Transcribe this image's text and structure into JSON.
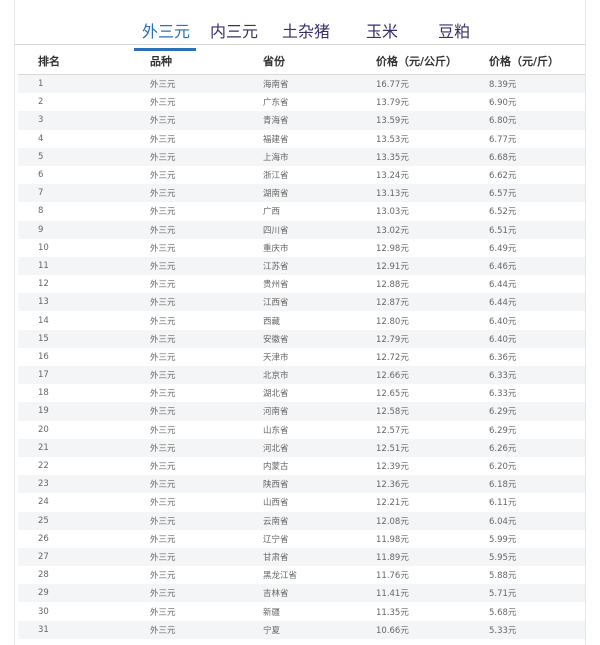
{
  "tabs": [
    "外三元",
    "内三元",
    "土杂猪",
    "玉米",
    "豆粕"
  ],
  "table": {
    "headers": [
      "排名",
      "品种",
      "省份",
      "价格（元/公斤）",
      "价格（元/斤）"
    ],
    "rows": [
      [
        "1",
        "外三元",
        "海南省",
        "16.77元",
        "8.39元"
      ],
      [
        "2",
        "外三元",
        "广东省",
        "13.79元",
        "6.90元"
      ],
      [
        "3",
        "外三元",
        "青海省",
        "13.59元",
        "6.80元"
      ],
      [
        "4",
        "外三元",
        "福建省",
        "13.53元",
        "6.77元"
      ],
      [
        "5",
        "外三元",
        "上海市",
        "13.35元",
        "6.68元"
      ],
      [
        "6",
        "外三元",
        "浙江省",
        "13.24元",
        "6.62元"
      ],
      [
        "7",
        "外三元",
        "湖南省",
        "13.13元",
        "6.57元"
      ],
      [
        "8",
        "外三元",
        "广西",
        "13.03元",
        "6.52元"
      ],
      [
        "9",
        "外三元",
        "四川省",
        "13.02元",
        "6.51元"
      ],
      [
        "10",
        "外三元",
        "重庆市",
        "12.98元",
        "6.49元"
      ],
      [
        "11",
        "外三元",
        "江苏省",
        "12.91元",
        "6.46元"
      ],
      [
        "12",
        "外三元",
        "贵州省",
        "12.88元",
        "6.44元"
      ],
      [
        "13",
        "外三元",
        "江西省",
        "12.87元",
        "6.44元"
      ],
      [
        "14",
        "外三元",
        "西藏",
        "12.80元",
        "6.40元"
      ],
      [
        "15",
        "外三元",
        "安徽省",
        "12.79元",
        "6.40元"
      ],
      [
        "16",
        "外三元",
        "天津市",
        "12.72元",
        "6.36元"
      ],
      [
        "17",
        "外三元",
        "北京市",
        "12.66元",
        "6.33元"
      ],
      [
        "18",
        "外三元",
        "湖北省",
        "12.65元",
        "6.33元"
      ],
      [
        "19",
        "外三元",
        "河南省",
        "12.58元",
        "6.29元"
      ],
      [
        "20",
        "外三元",
        "山东省",
        "12.57元",
        "6.29元"
      ],
      [
        "21",
        "外三元",
        "河北省",
        "12.51元",
        "6.26元"
      ],
      [
        "22",
        "外三元",
        "内蒙古",
        "12.39元",
        "6.20元"
      ],
      [
        "23",
        "外三元",
        "陕西省",
        "12.36元",
        "6.18元"
      ],
      [
        "24",
        "外三元",
        "山西省",
        "12.21元",
        "6.11元"
      ],
      [
        "25",
        "外三元",
        "云南省",
        "12.08元",
        "6.04元"
      ],
      [
        "26",
        "外三元",
        "辽宁省",
        "11.98元",
        "5.99元"
      ],
      [
        "27",
        "外三元",
        "甘肃省",
        "11.89元",
        "5.95元"
      ],
      [
        "28",
        "外三元",
        "黑龙江省",
        "11.76元",
        "5.88元"
      ],
      [
        "29",
        "外三元",
        "吉林省",
        "11.41元",
        "5.71元"
      ],
      [
        "30",
        "外三元",
        "新疆",
        "11.35元",
        "5.68元"
      ],
      [
        "31",
        "外三元",
        "宁夏",
        "10.66元",
        "5.33元"
      ]
    ]
  }
}
